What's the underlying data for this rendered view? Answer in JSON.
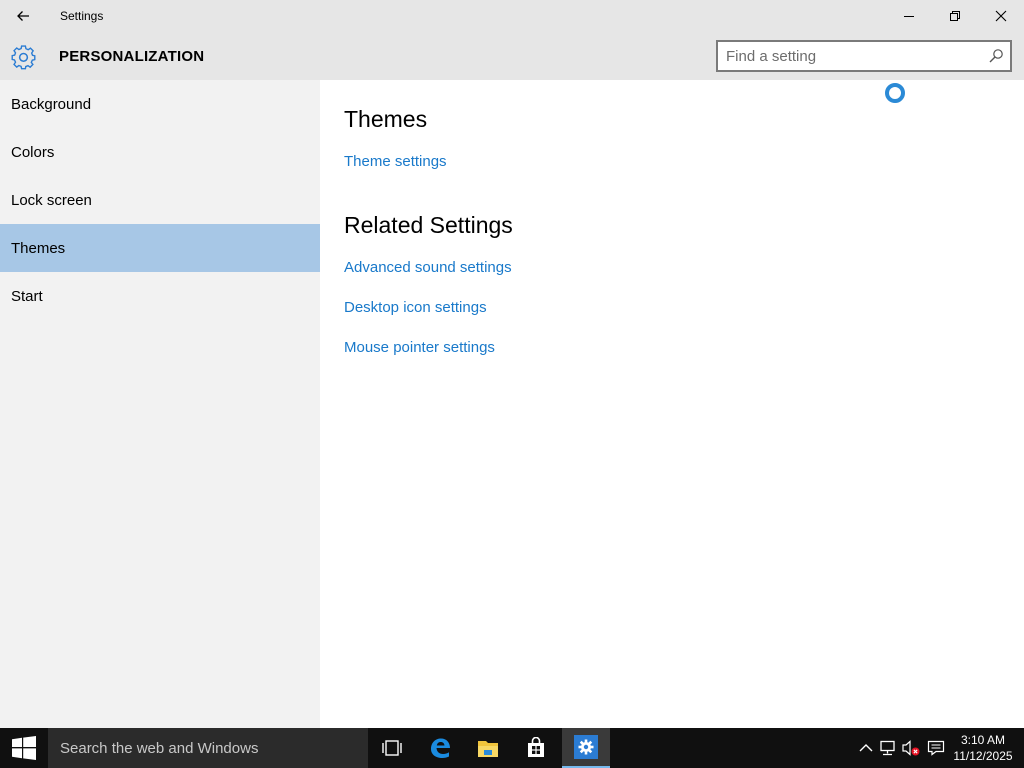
{
  "window": {
    "title": "Settings",
    "controls": {
      "minimize": "minimize-icon",
      "maximize": "restore-icon",
      "close": "close-icon"
    }
  },
  "header": {
    "section_title": "PERSONALIZATION",
    "search_placeholder": "Find a setting"
  },
  "sidebar": {
    "items": [
      {
        "label": "Background",
        "selected": false
      },
      {
        "label": "Colors",
        "selected": false
      },
      {
        "label": "Lock screen",
        "selected": false
      },
      {
        "label": "Themes",
        "selected": true
      },
      {
        "label": "Start",
        "selected": false
      }
    ]
  },
  "content": {
    "themes_heading": "Themes",
    "theme_settings_link": "Theme settings",
    "related_heading": "Related Settings",
    "related_links": [
      "Advanced sound settings",
      "Desktop icon settings",
      "Mouse pointer settings"
    ]
  },
  "taskbar": {
    "search_placeholder": "Search the web and Windows",
    "apps": [
      "task-view-icon",
      "edge-icon",
      "file-explorer-icon",
      "store-icon",
      "settings-icon"
    ],
    "clock_time": "3:10 AM",
    "clock_date": "11/12/2025"
  },
  "colors": {
    "accent": "#1979ca",
    "selection": "#a7c7e6",
    "chrome": "#e6e6e6",
    "sidebar": "#f2f2f2",
    "taskbar": "#101010"
  }
}
